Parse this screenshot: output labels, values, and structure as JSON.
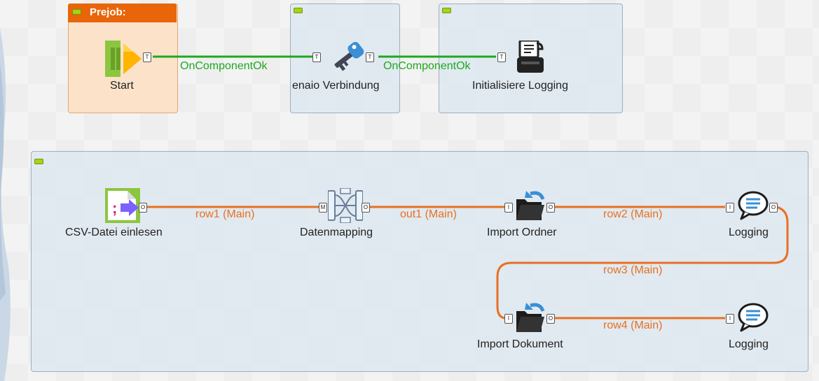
{
  "subjobs": {
    "prejob_title": "Prejob:"
  },
  "components": {
    "start": "Start",
    "enaio": "enaio Verbindung",
    "init_logging": "Initialisiere Logging",
    "csv": "CSV-Datei einlesen",
    "mapping": "Datenmapping",
    "import_ordner": "Import Ordner",
    "logging1": "Logging",
    "import_dokument": "Import Dokument",
    "logging2": "Logging"
  },
  "connections": {
    "trigger1": "OnComponentOk",
    "trigger2": "OnComponentOk",
    "row1": "row1 (Main)",
    "out1": "out1 (Main)",
    "row2": "row2 (Main)",
    "row3": "row3 (Main)",
    "row4": "row4 (Main)"
  },
  "ports": {
    "trigger": "T",
    "output": "O",
    "input": "I",
    "main": "M"
  },
  "colors": {
    "trigger_link": "#1fa81f",
    "row_link": "#e87022",
    "prejob_header": "#e8650a",
    "collapse_button": "#a8d21a"
  },
  "icons": {
    "start": "start-play-icon",
    "enaio": "key-icon",
    "init_logging": "printer-icon",
    "csv": "csv-file-icon",
    "mapping": "map-icon",
    "import": "folder-import-icon",
    "logging": "speech-bubble-icon"
  }
}
